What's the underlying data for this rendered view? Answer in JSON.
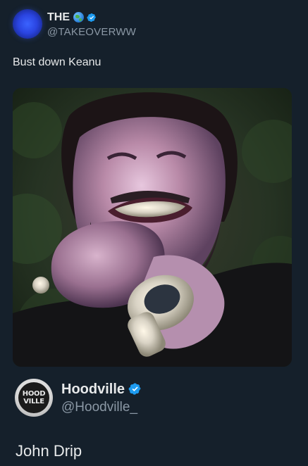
{
  "tweet": {
    "author_name": "THE",
    "author_emoji_icon": "globe-icon",
    "author_handle": "@TAKEOVERWW",
    "verified_icon": "verified-badge-icon",
    "text": "Bust down Keanu",
    "media": {
      "description_icon": "photo-media"
    }
  },
  "quoted": {
    "author_name": "Hoodville",
    "author_handle": "@Hoodville_",
    "avatar_logo_text": [
      "HOOD",
      "VILLE"
    ],
    "verified_icon": "verified-badge-icon",
    "text": "John Drip"
  },
  "colors": {
    "background": "#15202b",
    "text_primary": "#e7e9ea",
    "text_secondary": "#8b98a5",
    "verified_blue": "#1d9bf0"
  }
}
